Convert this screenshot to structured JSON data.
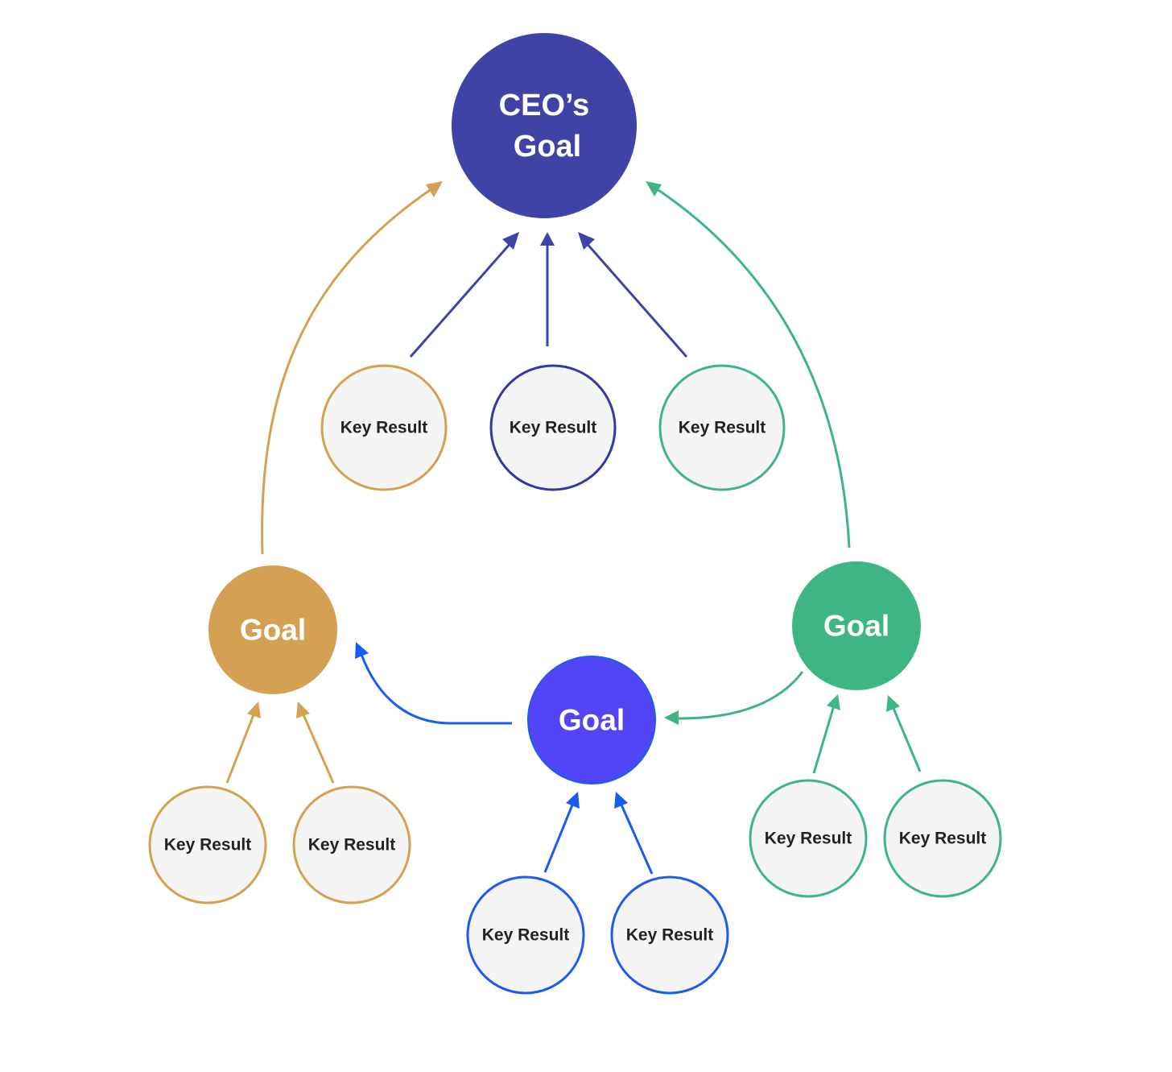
{
  "colors": {
    "ceo": "#4043A6",
    "gold": "#D4A052",
    "green": "#3DB585",
    "blue_goal_fill": "#5245F5",
    "blue": "#1A5CF0",
    "kr_fill": "#F5F5F5",
    "kr_text": "#222222"
  },
  "ceo_goal": {
    "line1": "CEO’s",
    "line2": "Goal"
  },
  "goals": [
    {
      "id": "gold",
      "label": "Goal"
    },
    {
      "id": "blue",
      "label": "Goal"
    },
    {
      "id": "green",
      "label": "Goal"
    }
  ],
  "key_results": {
    "ceo": [
      "Key Result",
      "Key Result",
      "Key Result"
    ],
    "gold": [
      "Key Result",
      "Key Result"
    ],
    "blue": [
      "Key Result",
      "Key Result"
    ],
    "green": [
      "Key Result",
      "Key Result"
    ]
  }
}
